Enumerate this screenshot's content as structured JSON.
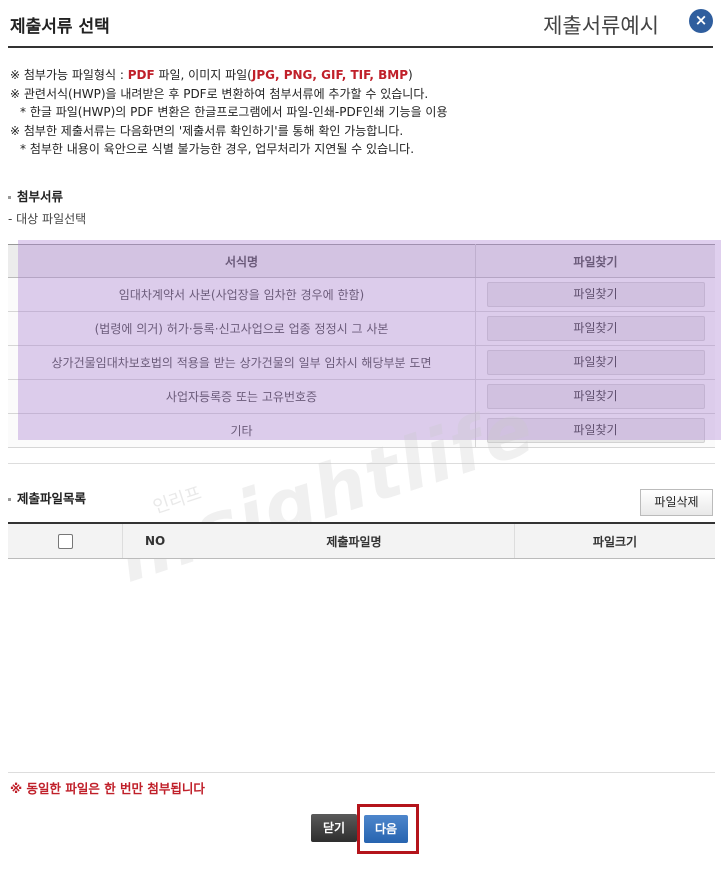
{
  "header": {
    "title": "제출서류 선택",
    "example_link": "제출서류예시",
    "close_icon": "×"
  },
  "notices": {
    "line1_prefix": "※ 첨부가능 파일형식 : ",
    "line1_pdf": "PDF",
    "line1_mid": " 파일, 이미지 파일(",
    "line1_formats": "JPG, PNG, GIF, TIF, BMP",
    "line1_suffix": ")",
    "line2": "※ 관련서식(HWP)을 내려받은 후 PDF로 변환하여 첨부서류에 추가할 수 있습니다.",
    "line3": "* 한글 파일(HWP)의 PDF 변환은 한글프로그램에서 파일-인쇄-PDF인쇄 기능을 이용",
    "line4": "※ 첨부한 제출서류는 다음화면의 '제출서류 확인하기'를 통해 확인 가능합니다.",
    "line5": "* 첨부한 내용이 육안으로 식별 불가능한 경우, 업무처리가 지연될 수 있습니다."
  },
  "attach_section": {
    "title": "첨부서류",
    "sub_label": "- 대상 파일선택",
    "columns": [
      "서식명",
      "파일찾기"
    ],
    "rows": [
      {
        "name": "임대차계약서 사본(사업장을 임차한 경우에 한함)",
        "button": "파일찾기"
      },
      {
        "name": "(법령에 의거) 허가·등록·신고사업으로 업종 정정시 그 사본",
        "button": "파일찾기"
      },
      {
        "name": "상가건물임대차보호법의 적용을 받는 상가건물의 일부 임차시 해당부분 도면",
        "button": "파일찾기"
      },
      {
        "name": "사업자등록증 또는 고유번호증",
        "button": "파일찾기"
      },
      {
        "name": "기타",
        "button": "파일찾기"
      }
    ]
  },
  "file_section": {
    "title": "제출파일목록",
    "delete_button": "파일삭제",
    "columns": [
      "NO",
      "제출파일명",
      "파일크기"
    ]
  },
  "warning": "※ 동일한 파일은 한 번만 첨부됩니다",
  "buttons": {
    "close": "닫기",
    "next": "다음"
  },
  "watermark": {
    "main": "insightlife",
    "small": "인리프"
  },
  "colors": {
    "accent_red": "#c0202a",
    "primary_blue": "#2764b0",
    "highlight_purple": "#aa82d2"
  }
}
